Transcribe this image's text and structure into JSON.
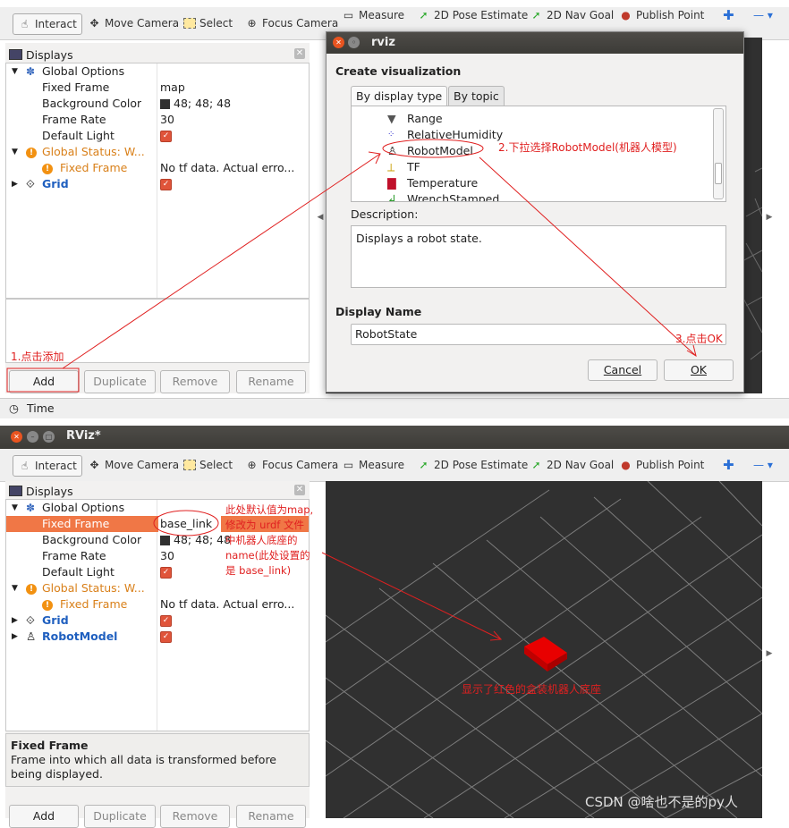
{
  "top": {
    "toolbar": {
      "interact": "Interact",
      "move_camera": "Move Camera",
      "select": "Select",
      "focus_camera": "Focus Camera",
      "measure": "Measure",
      "pose_estimate": "2D Pose Estimate",
      "nav_goal": "2D Nav Goal",
      "publish_point": "Publish Point"
    },
    "displays": {
      "title": "Displays",
      "rows": {
        "global_options": "Global Options",
        "fixed_frame": "Fixed Frame",
        "fixed_frame_value": "map",
        "background_color": "Background Color",
        "background_color_value": "48; 48; 48",
        "frame_rate": "Frame Rate",
        "frame_rate_value": "30",
        "default_light": "Default Light",
        "global_status": "Global Status: W...",
        "status_fixed_frame": "Fixed Frame",
        "status_fixed_frame_value": "No tf data.  Actual erro...",
        "grid": "Grid"
      }
    },
    "buttons": {
      "add": "Add",
      "duplicate": "Duplicate",
      "remove": "Remove",
      "rename": "Rename"
    },
    "time_label": "Time",
    "annotations": {
      "step1": "1.点击添加",
      "step2": "2.下拉选择RobotModel(机器人模型)",
      "step3": "3.点击OK"
    },
    "dialog": {
      "title": "rviz",
      "heading": "Create visualization",
      "tab_display_type": "By display type",
      "tab_topic": "By topic",
      "items": [
        "Range",
        "RelativeHumidity",
        "RobotModel",
        "TF",
        "Temperature",
        "WrenchStamped"
      ],
      "description_label": "Description:",
      "description_text": "Displays a robot state.",
      "display_name_label": "Display Name",
      "display_name_value": "RobotState",
      "cancel": "Cancel",
      "ok": "OK"
    }
  },
  "bottom": {
    "window_title": "RViz*",
    "toolbar": {
      "interact": "Interact",
      "move_camera": "Move Camera",
      "select": "Select",
      "focus_camera": "Focus Camera",
      "measure": "Measure",
      "pose_estimate": "2D Pose Estimate",
      "nav_goal": "2D Nav Goal",
      "publish_point": "Publish Point"
    },
    "displays": {
      "title": "Displays",
      "rows": {
        "global_options": "Global Options",
        "fixed_frame": "Fixed Frame",
        "fixed_frame_value": "base_link",
        "background_color": "Background Color",
        "background_color_value": "48; 48; 48",
        "frame_rate": "Frame Rate",
        "frame_rate_value": "30",
        "default_light": "Default Light",
        "global_status": "Global Status: W...",
        "status_fixed_frame": "Fixed Frame",
        "status_fixed_frame_value": "No tf data.  Actual erro...",
        "grid": "Grid",
        "robot_model": "RobotModel"
      }
    },
    "help": {
      "title": "Fixed Frame",
      "text": "Frame into which all data is transformed before being displayed."
    },
    "buttons": {
      "add": "Add",
      "duplicate": "Duplicate",
      "remove": "Remove",
      "rename": "Rename"
    },
    "annotations": {
      "note_lines": [
        "此处默认值为map,",
        "修改为 urdf 文件",
        "中机器人底座的",
        "name(此处设置的",
        "是 base_link)"
      ],
      "robot_note": "显示了红色的盒装机器人底座"
    },
    "watermark": "CSDN @啥也不是的py人"
  },
  "colors": {
    "viewport": "#303030",
    "selected_row": "#f07746",
    "annotation": "#e02020",
    "robot": "#cc0000"
  }
}
